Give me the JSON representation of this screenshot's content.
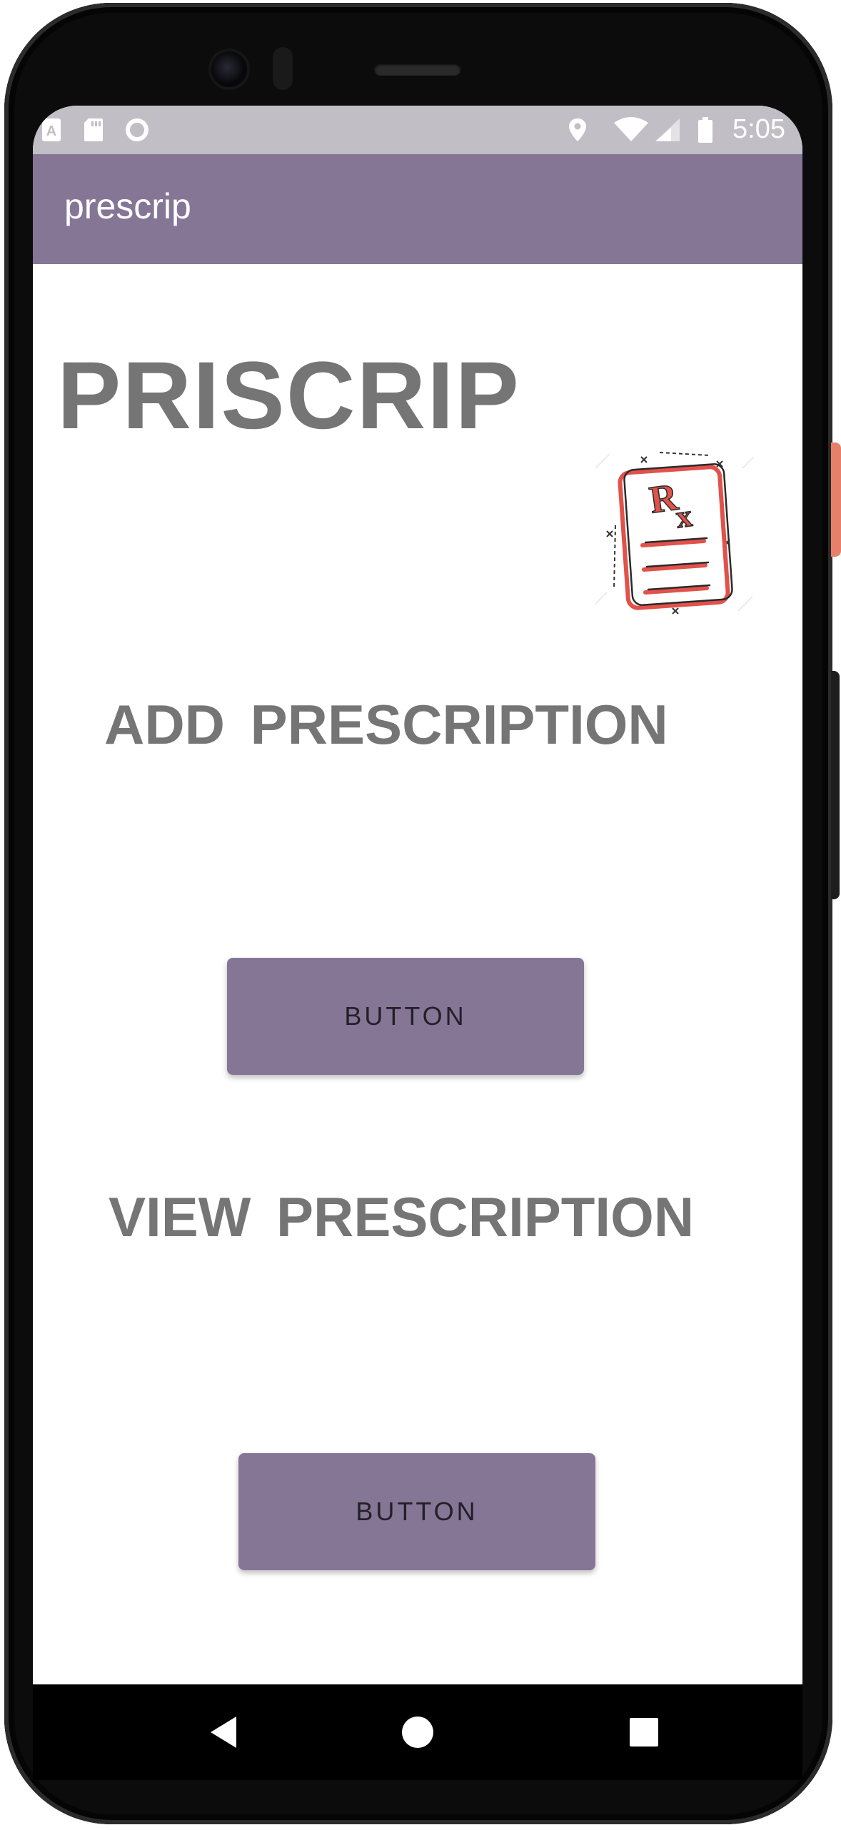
{
  "status_bar": {
    "time": "5:05",
    "icons": [
      "notification-a-icon",
      "sd-card-icon",
      "circle-sync-icon",
      "location-icon",
      "wifi-icon",
      "cell-signal-icon",
      "battery-icon"
    ]
  },
  "app_bar": {
    "title": "prescrip"
  },
  "main": {
    "heading": "PRISCRIP",
    "add_heading": "ADD PRESCRIPTION",
    "add_button_label": "BUTTON",
    "view_heading": "VIEW PRESCRIPTION",
    "view_button_label": "BUTTON",
    "illustration": "rx-prescription-icon"
  },
  "nav_bar": {
    "buttons": [
      "back-icon",
      "home-icon",
      "recents-icon"
    ]
  },
  "colors": {
    "primary": "#857696",
    "status_bar": "#c2bec6",
    "heading_text": "#757575",
    "button_text": "#231f29",
    "rx_accent": "#e0524a"
  }
}
